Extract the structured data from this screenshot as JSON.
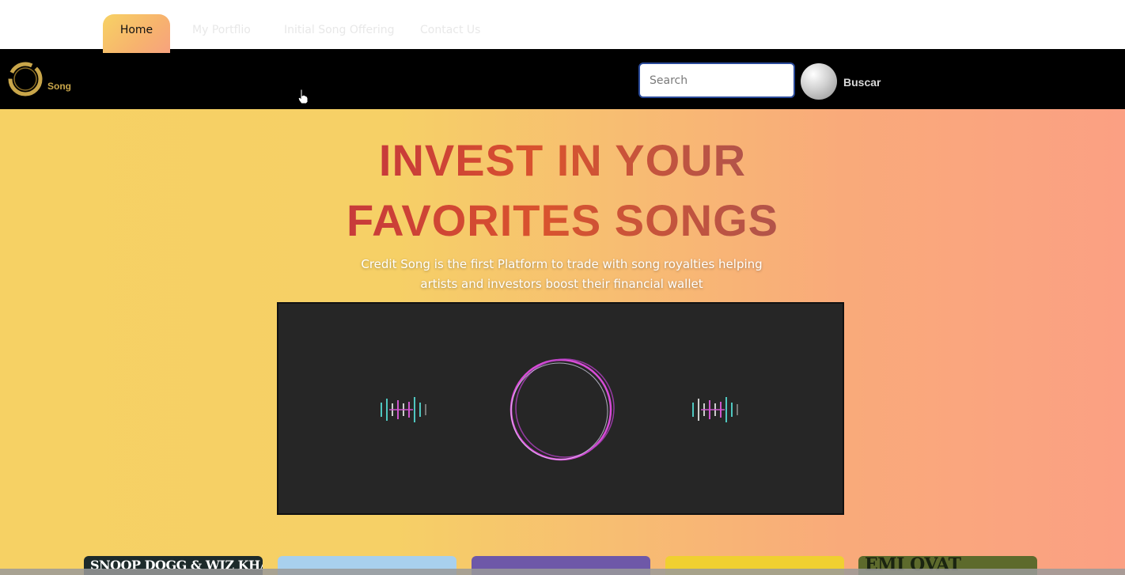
{
  "navbar": {
    "logo_text": "Song",
    "items": [
      {
        "label": "Home",
        "active": true
      },
      {
        "label": "My Portflio"
      },
      {
        "label": "Initial Song Offering"
      },
      {
        "label": "Contact Us"
      }
    ],
    "search_placeholder": "Search",
    "search_button": "Buscar"
  },
  "hero": {
    "title_line1": "INVEST IN YOUR",
    "title_line2": "FAVORITES SONGS",
    "subtitle": "Credit Song is the first Platform to trade with song royalties helping artists and investors boost their financial wallet"
  },
  "cards": [
    {
      "text": "SNOOP DOGG & WIZ KHALIFA"
    },
    {
      "text": ""
    },
    {
      "text": ""
    },
    {
      "text": ""
    },
    {
      "text": "EMI OVAT"
    }
  ],
  "colors": {
    "navbar_bg": "#000000",
    "accent_gold": "#c9a64a",
    "hero_left": "#f6d164",
    "hero_right": "#fba083",
    "title_red": "#c73a3a"
  }
}
